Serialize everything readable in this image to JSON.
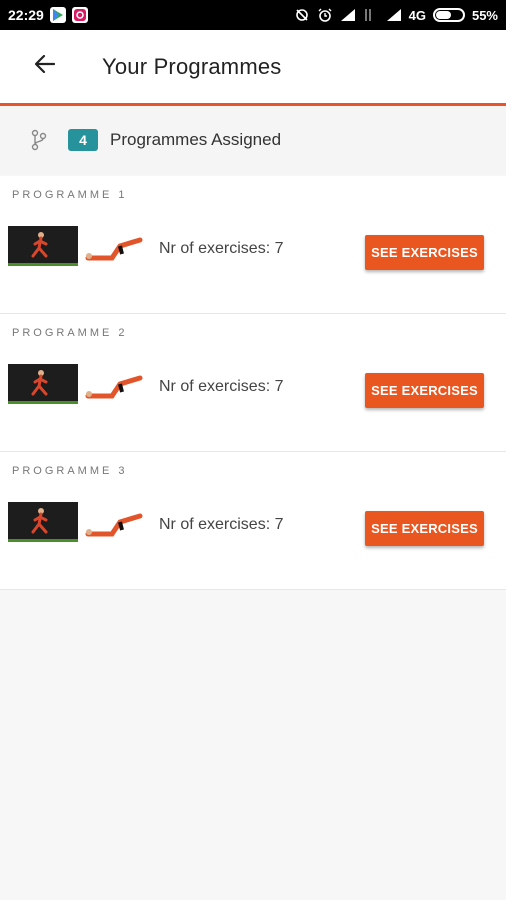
{
  "status_bar": {
    "time": "22:29",
    "network": "4G",
    "battery": "55%",
    "battery_level": 0.55
  },
  "app_bar": {
    "title": "Your Programmes",
    "back_icon": "arrow-left-icon"
  },
  "summary": {
    "count": "4",
    "label": "Programmes Assigned",
    "icon": "branch-icon"
  },
  "programmes": [
    {
      "header": "PROGRAMME 1",
      "exercises": "Nr of exercises: 7",
      "button": "SEE EXERCISES"
    },
    {
      "header": "PROGRAMME 2",
      "exercises": "Nr of exercises: 7",
      "button": "SEE EXERCISES"
    },
    {
      "header": "PROGRAMME 3",
      "exercises": "Nr of exercises: 7",
      "button": "SEE EXERCISES"
    }
  ],
  "colors": {
    "accent": "#e8542b",
    "button": "#e9561f",
    "badge": "#26939c"
  }
}
